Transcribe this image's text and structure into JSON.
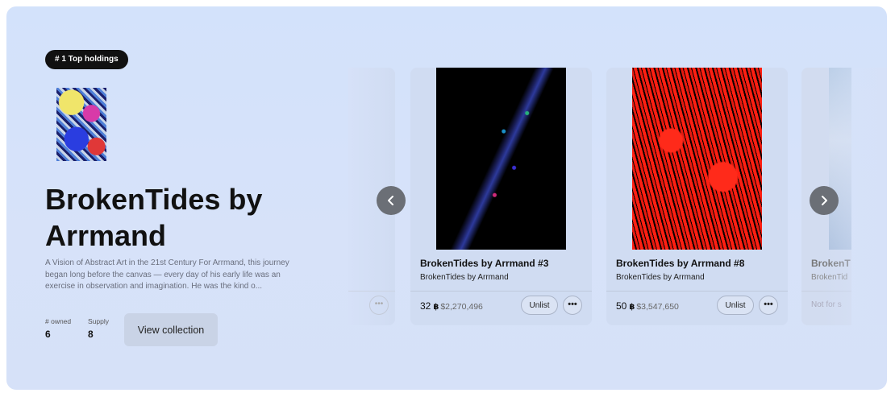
{
  "badge": "# 1 Top holdings",
  "collection": {
    "title": "BrokenTides by Arrmand",
    "description": "A Vision of Abstract Art in the 21st Century For Arrmand, this journey began long before the canvas — every day of his early life was an exercise in observation and imagination. He was the kind o...",
    "owned_label": "# owned",
    "owned_value": "6",
    "supply_label": "Supply",
    "supply_value": "8",
    "view_button": "View collection"
  },
  "carousel": {
    "prev_icon": "chevron-left-icon",
    "next_icon": "chevron-right-icon",
    "cards": [
      {
        "name": "BrokenTides by Arrmand #3",
        "collection": "BrokenTides by Arrmand",
        "quantity": "32",
        "coin": "฿",
        "usd": "$2,270,496",
        "unlist": "Unlist",
        "more": "•••"
      },
      {
        "name": "BrokenTides by Arrmand #8",
        "collection": "BrokenTides by Arrmand",
        "quantity": "50",
        "coin": "฿",
        "usd": "$3,547,650",
        "unlist": "Unlist",
        "more": "•••"
      }
    ],
    "partial_right": {
      "name": "BrokenT",
      "collection": "BrokenTid",
      "status": "Not for s"
    },
    "partial_left_more": "•••"
  }
}
